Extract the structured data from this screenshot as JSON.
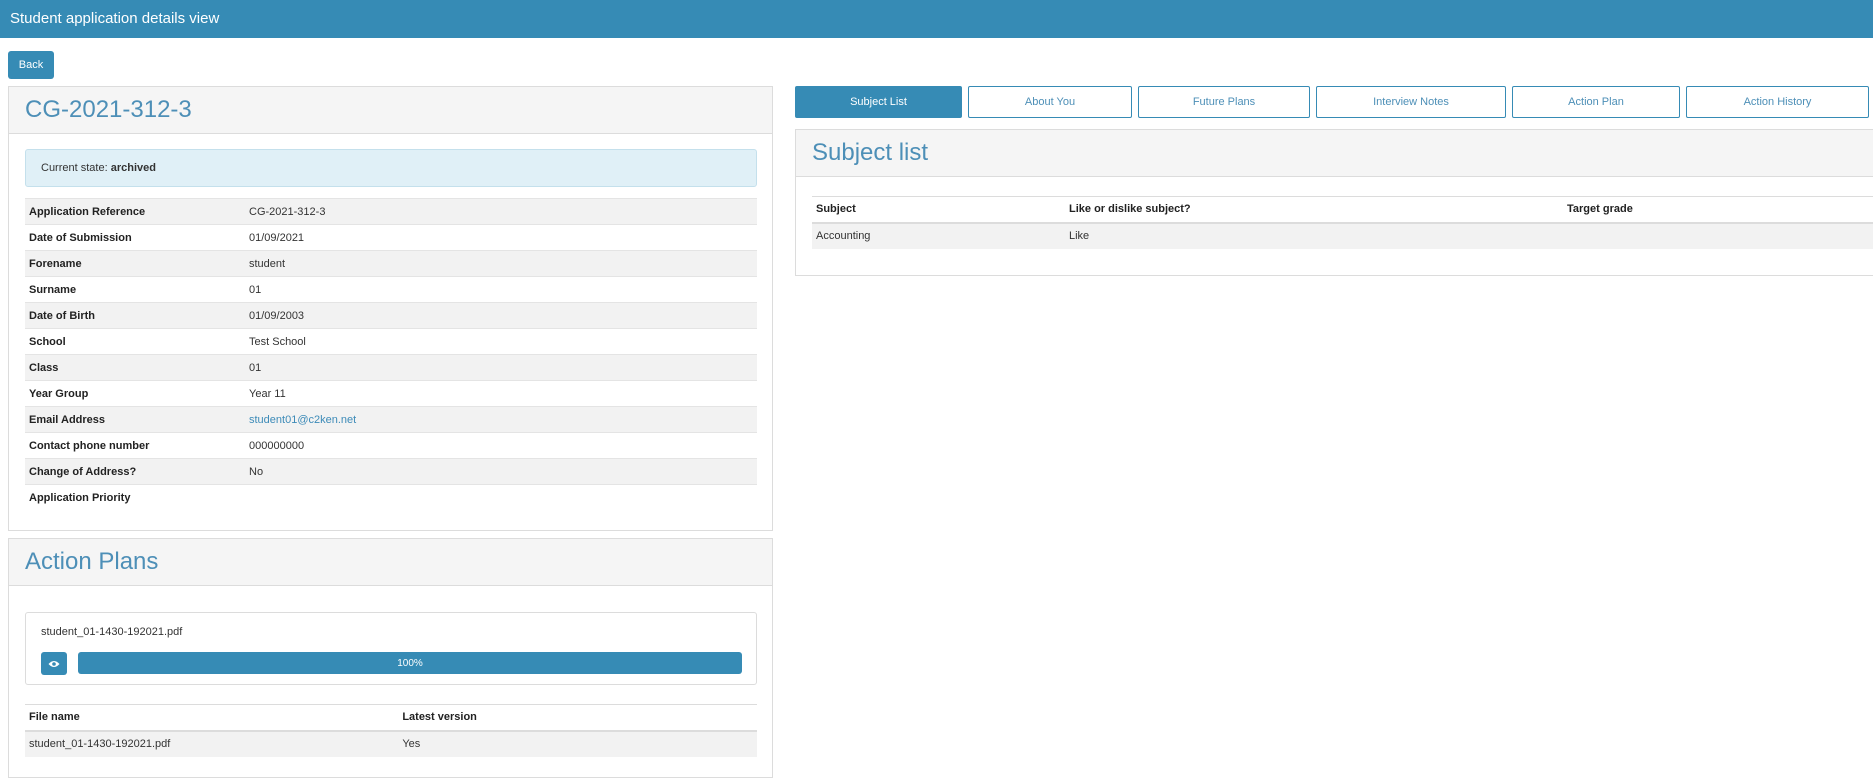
{
  "app": {
    "title": "Student application details view"
  },
  "actions": {
    "back_label": "Back"
  },
  "application": {
    "reference_title": "CG-2021-312-3",
    "state_prefix": "Current state:",
    "state_value": "archived",
    "fields": [
      {
        "label": "Application Reference",
        "value": "CG-2021-312-3"
      },
      {
        "label": "Date of Submission",
        "value": "01/09/2021"
      },
      {
        "label": "Forename",
        "value": "student"
      },
      {
        "label": "Surname",
        "value": "01"
      },
      {
        "label": "Date of Birth",
        "value": "01/09/2003"
      },
      {
        "label": "School",
        "value": "Test School"
      },
      {
        "label": "Class",
        "value": "01"
      },
      {
        "label": "Year Group",
        "value": "Year 11"
      },
      {
        "label": "Email Address",
        "value": "student01@c2ken.net"
      },
      {
        "label": "Contact phone number",
        "value": "000000000"
      },
      {
        "label": "Change of Address?",
        "value": "No"
      },
      {
        "label": "Application Priority",
        "value": ""
      }
    ]
  },
  "action_plans": {
    "title": "Action Plans",
    "upload": {
      "file_name": "student_01-1430-192021.pdf",
      "progress_label": "100%",
      "progress": 1.0
    },
    "columns": [
      "File name",
      "Latest version"
    ],
    "rows": [
      [
        "student_01-1430-192021.pdf",
        "Yes"
      ]
    ]
  },
  "tabs": [
    {
      "label": "Subject List",
      "active": true
    },
    {
      "label": "About You",
      "active": false
    },
    {
      "label": "Future Plans",
      "active": false
    },
    {
      "label": "Interview Notes",
      "active": false
    },
    {
      "label": "Action Plan",
      "active": false
    },
    {
      "label": "Action History",
      "active": false
    }
  ],
  "subject_list": {
    "title": "Subject list",
    "columns": [
      "Subject",
      "Like or dislike subject?",
      "Target grade"
    ],
    "rows": [
      [
        "Accounting",
        "Like",
        ""
      ]
    ]
  },
  "icons": {
    "view": "eye-icon"
  },
  "colors": {
    "accent": "#368bb5",
    "heading": "#4d8fb7",
    "link": "#3d8bb8",
    "state_bg": "#e0f0f7"
  }
}
